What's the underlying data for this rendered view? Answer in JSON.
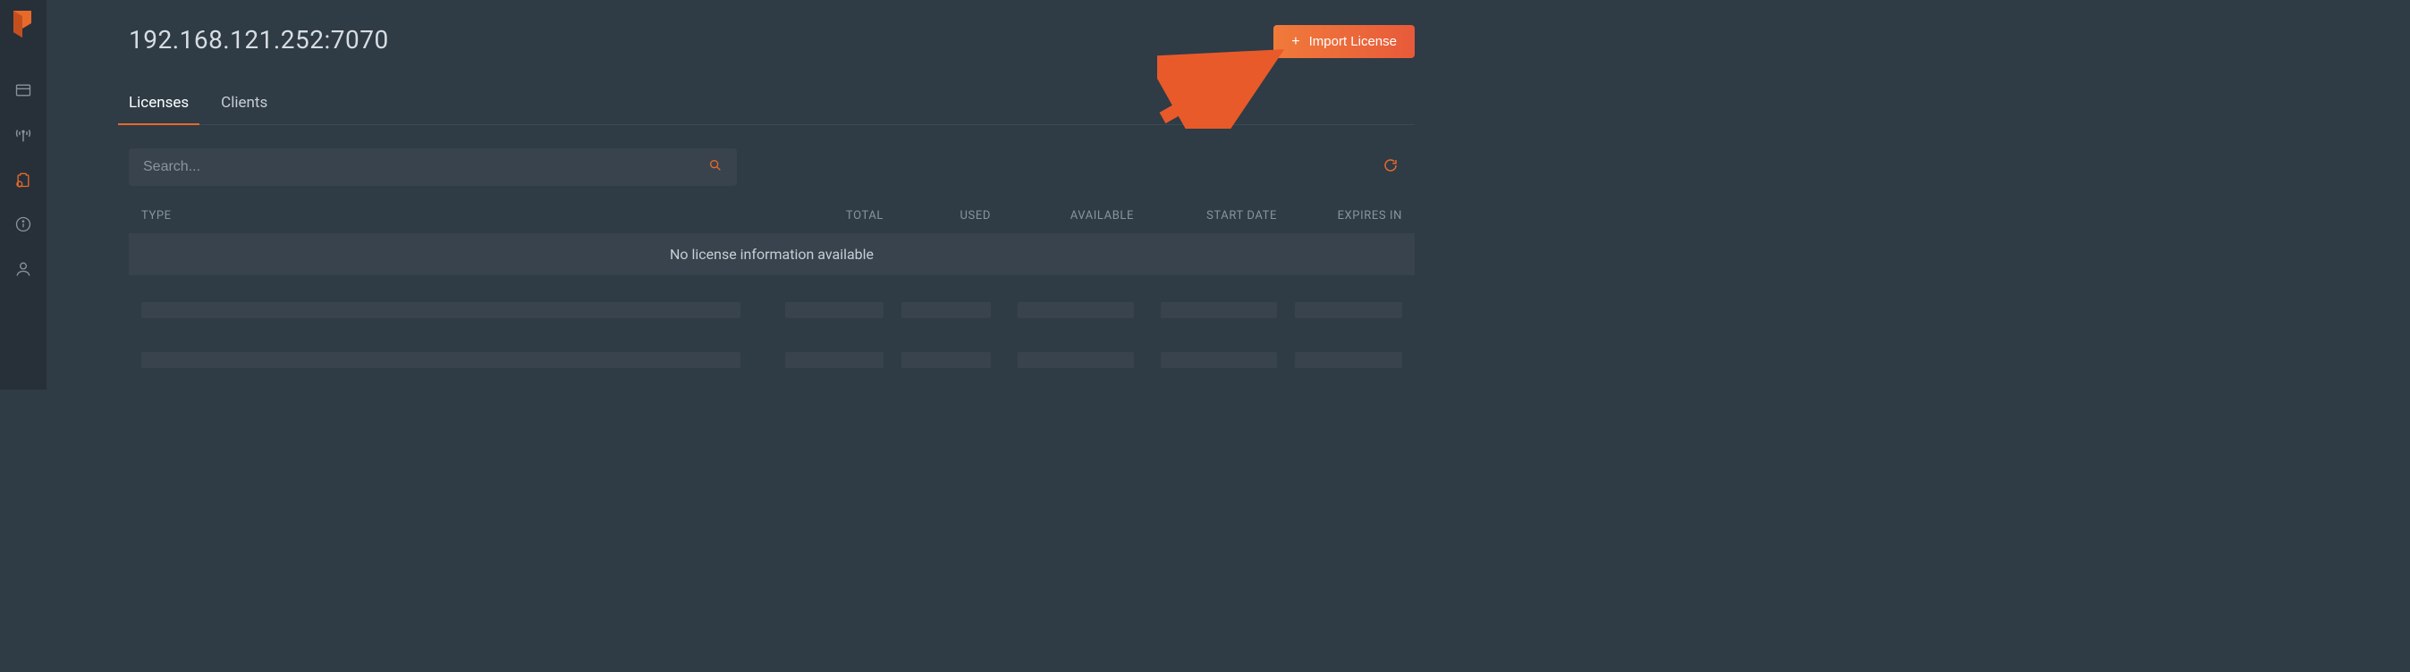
{
  "page_title": "192.168.121.252:7070",
  "import_button_label": "Import License",
  "tabs": {
    "licenses": "Licenses",
    "clients": "Clients"
  },
  "search": {
    "placeholder": "Search..."
  },
  "table": {
    "headers": {
      "type": "TYPE",
      "total": "TOTAL",
      "used": "USED",
      "available": "AVAILABLE",
      "start_date": "START DATE",
      "expires_in": "EXPIRES IN"
    },
    "empty_message": "No license information available"
  },
  "sidebar": {
    "items": [
      "dashboard",
      "broadcast",
      "clipboard",
      "info",
      "user"
    ],
    "active": "clipboard"
  },
  "colors": {
    "accent": "#e86a2a"
  }
}
